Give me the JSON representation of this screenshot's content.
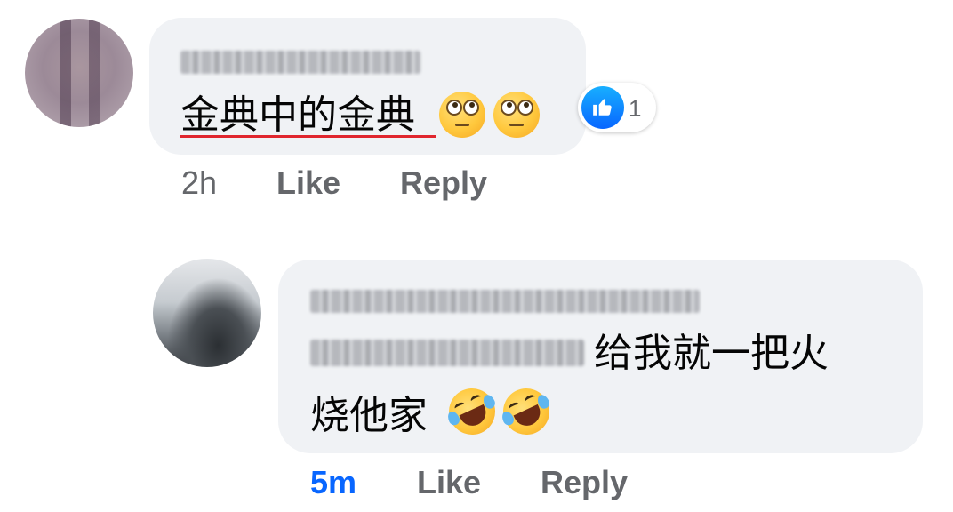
{
  "accent_color": "#0866ff",
  "comments": [
    {
      "author_redacted": true,
      "text": "金典中的金典",
      "emojis": [
        "face-with-rolling-eyes",
        "face-with-rolling-eyes"
      ],
      "reaction": {
        "icon": "thumbs-up-icon",
        "count": "1"
      },
      "time": "2h",
      "like_label": "Like",
      "reply_label": "Reply"
    },
    {
      "author_redacted": true,
      "mention_redacted": true,
      "text_line1": "给我就一把火",
      "text_line2": "烧他家",
      "emojis": [
        "rolling-on-the-floor-laughing",
        "rolling-on-the-floor-laughing"
      ],
      "time": "5m",
      "like_label": "Like",
      "reply_label": "Reply"
    }
  ]
}
